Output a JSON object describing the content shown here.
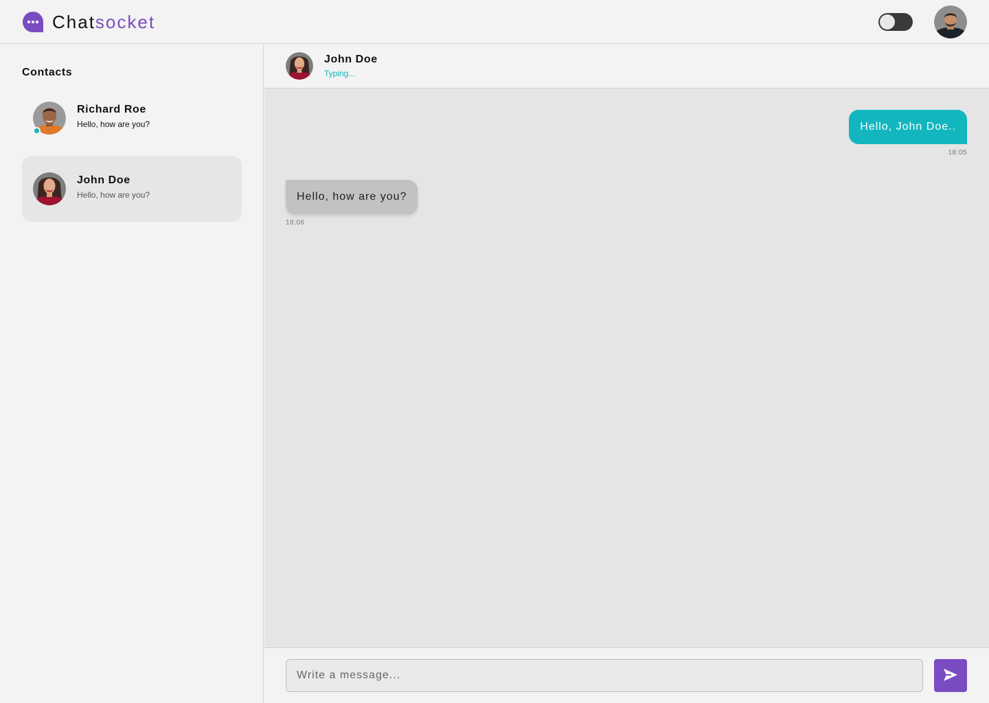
{
  "app": {
    "name_part1": "Chat",
    "name_part2": "socket",
    "logo_icon": "chat-bubble-icon",
    "brand_color": "#7a4cc2",
    "accent_color": "#13b3bd"
  },
  "header": {
    "theme_toggle": {
      "on": false,
      "icon": "toggle-switch"
    },
    "user_avatar_icon": "user-avatar"
  },
  "sidebar": {
    "title": "Contacts",
    "contacts": [
      {
        "name": "Richard Roe",
        "preview": "Hello, how are you?",
        "online": true,
        "active": false
      },
      {
        "name": "John Doe",
        "preview": "Hello, how are you?",
        "online": false,
        "active": true
      }
    ]
  },
  "chat": {
    "contact_name": "John Doe",
    "status": "Typing...",
    "messages": [
      {
        "direction": "sent",
        "text": "Hello, John Doe..",
        "time": "18:05"
      },
      {
        "direction": "received",
        "text": "Hello, how are you?",
        "time": "18:06"
      }
    ]
  },
  "composer": {
    "placeholder": "Write a message...",
    "value": "",
    "send_icon": "send-icon"
  }
}
